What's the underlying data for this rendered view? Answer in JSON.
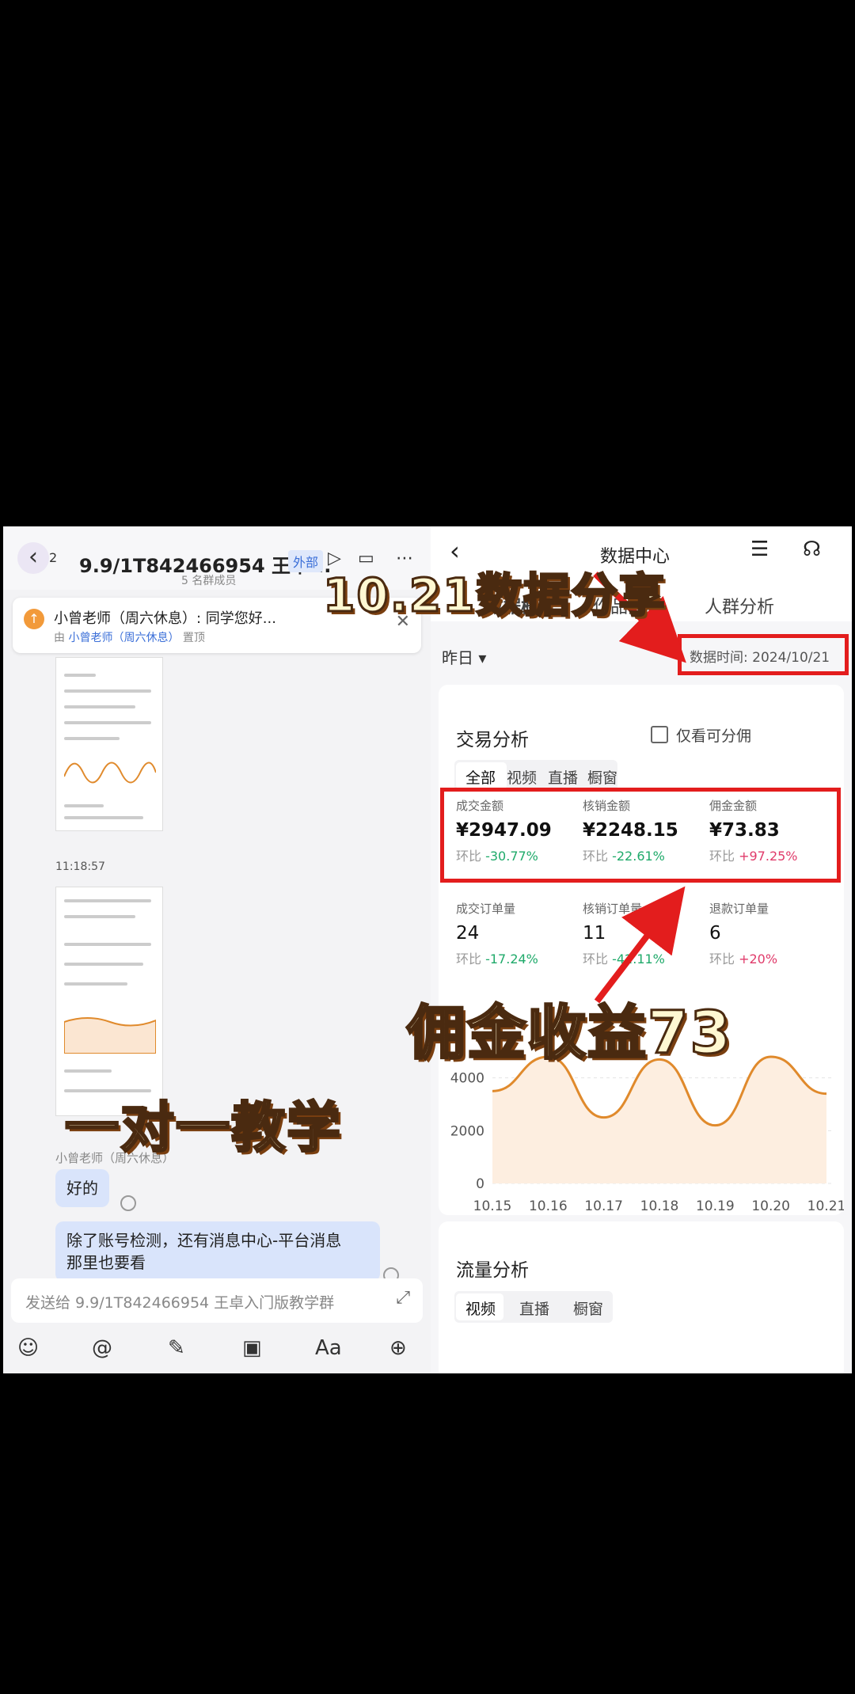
{
  "chat": {
    "back_count": "2",
    "group_title": "9.9/1T842466954 王卓...",
    "member_count": "5 名群成员",
    "external_tag": "外部",
    "pin": {
      "text": "小曾老师（周六休息）: 同学您好...",
      "sub_prefix": "由 ",
      "sub_name": "小曾老师（周六休息）",
      "sub_suffix": " 置顶"
    },
    "thumb1_time": "11:18:57",
    "sender": "小曾老师（周六休息）",
    "bubble1": "好的",
    "bubble2_line1": "除了账号检测，还有消息中心-平台消息",
    "bubble2_line2": "那里也要看",
    "input_placeholder": "发送给 9.9/1T842466954 王卓入门版教学群",
    "tools": [
      "smile-icon",
      "at-icon",
      "pen-icon",
      "image-icon",
      "font-icon",
      "plus-icon"
    ],
    "tool_glyphs": [
      "☺",
      "@",
      "✎",
      "▣",
      "Aa",
      "⊕"
    ]
  },
  "overlays": {
    "top": "10.21数据分享",
    "middle": "佣金收益73",
    "left": "一对一教学"
  },
  "datacenter": {
    "title": "数据中心",
    "tabs": [
      "数据概览",
      "作品分析",
      "人群分析"
    ],
    "range": "昨日 ▾",
    "data_time": "数据时间: 2024/10/21",
    "section_title": "交易分析",
    "only_commission": "仅看可分佣",
    "segments": [
      "全部",
      "视频",
      "直播",
      "橱窗"
    ],
    "metrics": [
      {
        "label": "成交金额",
        "value": "¥2947.09",
        "change_prefix": "环比 ",
        "change": "-30.77%",
        "trend": "neg"
      },
      {
        "label": "核销金额",
        "value": "¥2248.15",
        "change_prefix": "环比 ",
        "change": "-22.61%",
        "trend": "neg"
      },
      {
        "label": "佣金金额",
        "value": "¥73.83",
        "change_prefix": "环比 ",
        "change": "+97.25%",
        "trend": "pos"
      },
      {
        "label": "成交订单量",
        "value": "24",
        "change_prefix": "环比 ",
        "change": "-17.24%",
        "trend": "neg"
      },
      {
        "label": "核销订单量",
        "value": "11",
        "change_prefix": "环比 ",
        "change": "-42.11%",
        "trend": "neg"
      },
      {
        "label": "退款订单量",
        "value": "6",
        "change_prefix": "环比 ",
        "change": "+20%",
        "trend": "pos"
      }
    ],
    "flow_title": "流量分析",
    "flow_segments": [
      "视频",
      "直播",
      "橱窗"
    ]
  },
  "chart_data": {
    "type": "area",
    "categories": [
      "10.15",
      "10.16",
      "10.17",
      "10.18",
      "10.19",
      "10.20",
      "10.21"
    ],
    "y_ticks": [
      "0",
      "2000",
      "4000"
    ],
    "ylim": [
      0,
      6000
    ],
    "values": [
      3500,
      4800,
      2500,
      4700,
      2200,
      4800,
      3400
    ],
    "color": "#e08a2c"
  }
}
